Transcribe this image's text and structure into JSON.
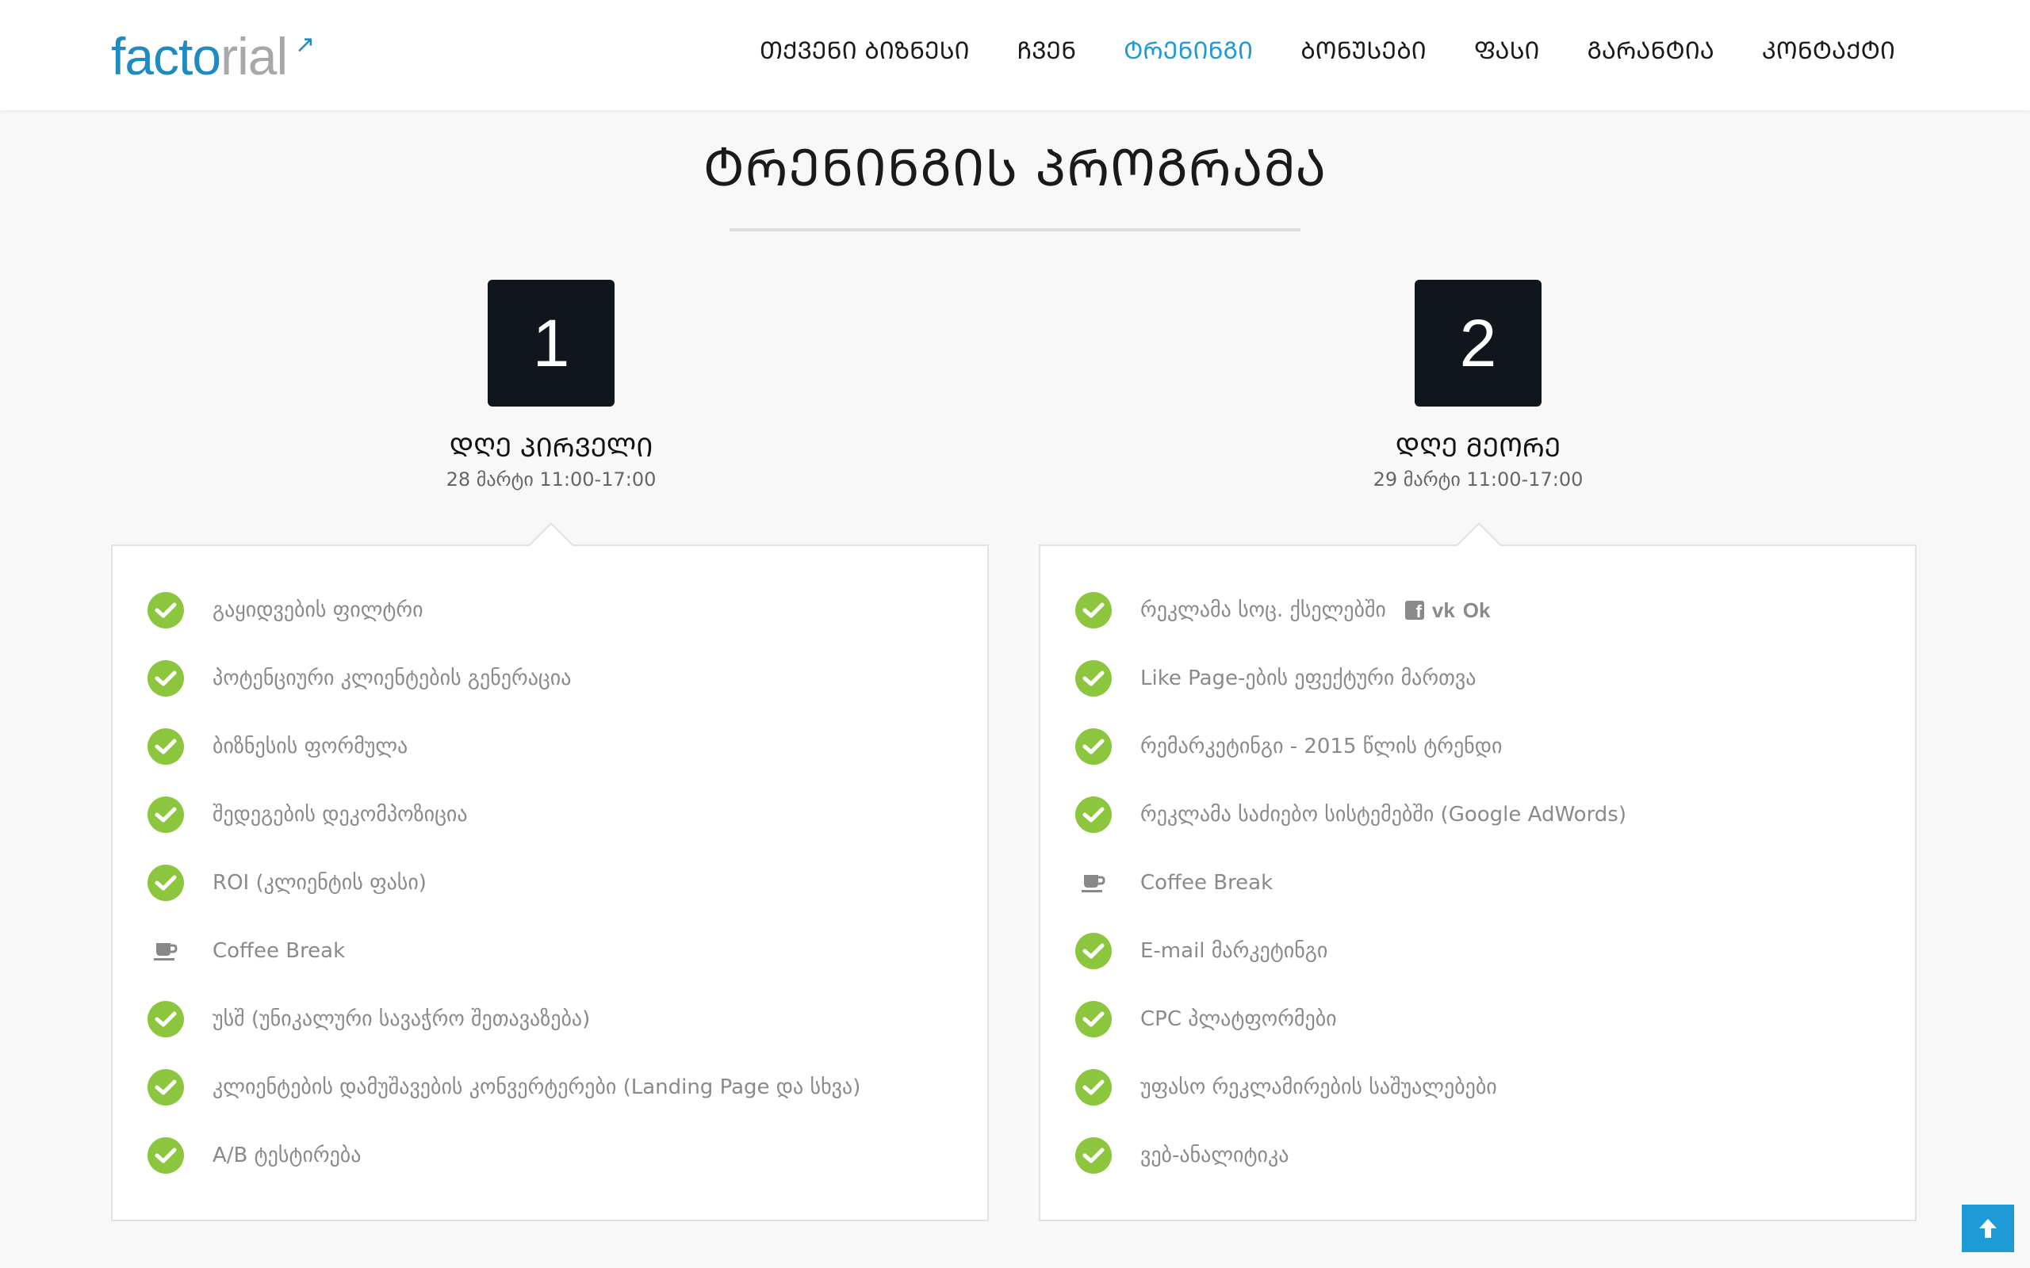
{
  "brand": {
    "logo_main": "fact",
    "logo_mid": "o",
    "logo_rest": "rial",
    "accent_color": "#1e9bd7",
    "check_color": "#8cc63f",
    "dark_box_color": "#11161c"
  },
  "nav": {
    "items": [
      {
        "label": "ᲗᲥᲕᲔᲜᲘ ᲑᲘᲖᲜᲔᲡᲘ",
        "active": false
      },
      {
        "label": "ᲩᲕᲔᲜ",
        "active": false
      },
      {
        "label": "ᲢᲠᲔᲜᲘᲜᲒᲘ",
        "active": true
      },
      {
        "label": "ᲑᲝᲜᲣᲡᲔᲑᲘ",
        "active": false
      },
      {
        "label": "ᲤᲐᲡᲘ",
        "active": false
      },
      {
        "label": "ᲒᲐᲠᲐᲜᲢᲘᲐ",
        "active": false
      },
      {
        "label": "ᲙᲝᲜᲢᲐᲥᲢᲘ",
        "active": false
      }
    ]
  },
  "section": {
    "title": "ᲢᲠᲔᲜᲘᲜᲒᲘᲡ ᲞᲠᲝᲒᲠᲐᲛᲐ"
  },
  "days": [
    {
      "number": "1",
      "title": "ᲓᲦᲔ ᲞᲘᲠᲕᲔᲚᲘ",
      "date": "28 მარტი 11:00-17:00",
      "items": [
        {
          "icon": "check-icon",
          "text": "გაყიდვების ფილტრი"
        },
        {
          "icon": "check-icon",
          "text": "პოტენციური კლიენტების გენერაცია"
        },
        {
          "icon": "check-icon",
          "text": "ბიზნესის ფორმულა"
        },
        {
          "icon": "check-icon",
          "text": "შედეგების დეკომპოზიცია"
        },
        {
          "icon": "check-icon",
          "text": "ROI (კლიენტის ფასი)"
        },
        {
          "icon": "coffee-cup-icon",
          "text": "Coffee Break"
        },
        {
          "icon": "check-icon",
          "text": "უსშ (უნიკალური სავაჭრო შეთავაზება)"
        },
        {
          "icon": "check-icon",
          "text": "კლიენტების დამუშავების კონვერტერები (Landing Page და სხვა)"
        },
        {
          "icon": "check-icon",
          "text": "A/B ტესტირება"
        }
      ]
    },
    {
      "number": "2",
      "title": "ᲓᲦᲔ ᲛᲔᲝᲠᲔ",
      "date": "29 მარტი 11:00-17:00",
      "items": [
        {
          "icon": "check-icon",
          "text": "რეკლამა სოც. ქსელებში",
          "social": [
            "f",
            "vk",
            "Ok"
          ]
        },
        {
          "icon": "check-icon",
          "text": "Like Page-ების ეფექტური მართვა"
        },
        {
          "icon": "check-icon",
          "text": "რემარკეტინგი - 2015 წლის ტრენდი"
        },
        {
          "icon": "check-icon",
          "text": "რეკლამა საძიებო სისტემებში (Google AdWords)"
        },
        {
          "icon": "coffee-cup-icon",
          "text": "Coffee Break"
        },
        {
          "icon": "check-icon",
          "text": "E-mail მარკეტინგი"
        },
        {
          "icon": "check-icon",
          "text": "CPC პლატფორმები"
        },
        {
          "icon": "check-icon",
          "text": "უფასო რეკლამირების საშუალებები"
        },
        {
          "icon": "check-icon",
          "text": "ვებ-ანალიტიკა"
        }
      ]
    }
  ]
}
